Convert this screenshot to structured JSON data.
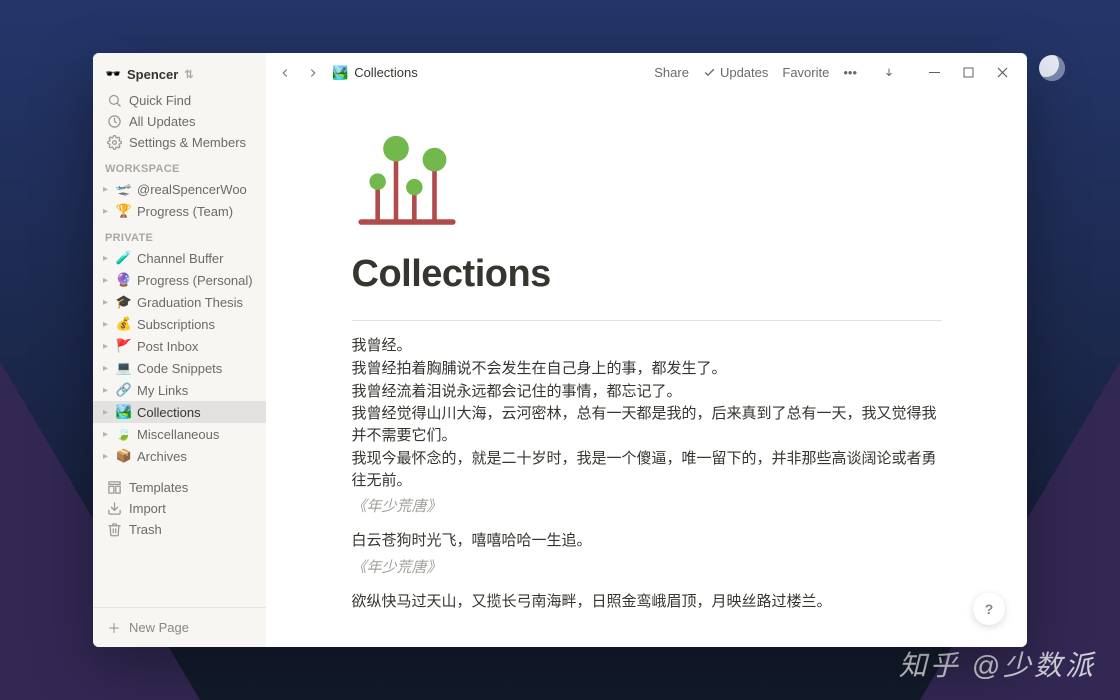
{
  "workspace": {
    "name": "Spencer",
    "icon": "🕶️"
  },
  "sidebar_primary": [
    {
      "icon": "search",
      "label": "Quick Find"
    },
    {
      "icon": "clock",
      "label": "All Updates"
    },
    {
      "icon": "gear",
      "label": "Settings & Members"
    }
  ],
  "sections": [
    {
      "title": "WORKSPACE",
      "pages": [
        {
          "emoji": "🛫",
          "label": "@realSpencerWoo"
        },
        {
          "emoji": "🏆",
          "label": "Progress (Team)"
        }
      ]
    },
    {
      "title": "PRIVATE",
      "pages": [
        {
          "emoji": "🧪",
          "label": "Channel Buffer"
        },
        {
          "emoji": "🔮",
          "label": "Progress (Personal)"
        },
        {
          "emoji": "🎓",
          "label": "Graduation Thesis"
        },
        {
          "emoji": "💰",
          "label": "Subscriptions"
        },
        {
          "emoji": "🚩",
          "label": "Post Inbox"
        },
        {
          "emoji": "💻",
          "label": "Code Snippets"
        },
        {
          "emoji": "🔗",
          "label": "My Links"
        },
        {
          "emoji": "🏞️",
          "label": "Collections",
          "active": true
        },
        {
          "emoji": "🍃",
          "label": "Miscellaneous"
        },
        {
          "emoji": "📦",
          "label": "Archives"
        }
      ]
    }
  ],
  "sidebar_secondary": [
    {
      "icon": "templates",
      "label": "Templates"
    },
    {
      "icon": "import",
      "label": "Import"
    },
    {
      "icon": "trash",
      "label": "Trash"
    }
  ],
  "new_page_label": "New Page",
  "breadcrumb": {
    "emoji": "🏞️",
    "title": "Collections"
  },
  "topbar_actions": {
    "share": "Share",
    "updates": "Updates",
    "favorite": "Favorite"
  },
  "page": {
    "title": "Collections",
    "body": [
      {
        "t": "p",
        "text": "我曾经。"
      },
      {
        "t": "p",
        "text": "我曾经拍着胸脯说不会发生在自己身上的事，都发生了。"
      },
      {
        "t": "p",
        "text": "我曾经流着泪说永远都会记住的事情，都忘记了。"
      },
      {
        "t": "p",
        "text": "我曾经觉得山川大海，云河密林，总有一天都是我的，后来真到了总有一天，我又觉得我并不需要它们。"
      },
      {
        "t": "p",
        "text": "我现今最怀念的，就是二十岁时，我是一个傻逼，唯一留下的，并非那些高谈阔论或者勇往无前。"
      },
      {
        "t": "cite",
        "text": "《年少荒唐》"
      },
      {
        "t": "p",
        "text": "白云苍狗时光飞，嘻嘻哈哈一生追。"
      },
      {
        "t": "cite",
        "text": "《年少荒唐》"
      },
      {
        "t": "p",
        "text": "欲纵快马过天山，又揽长弓南海畔，日照金鸾峨眉顶，月映丝路过楼兰。"
      }
    ]
  },
  "help_label": "?",
  "watermark": "知乎 @少数派"
}
